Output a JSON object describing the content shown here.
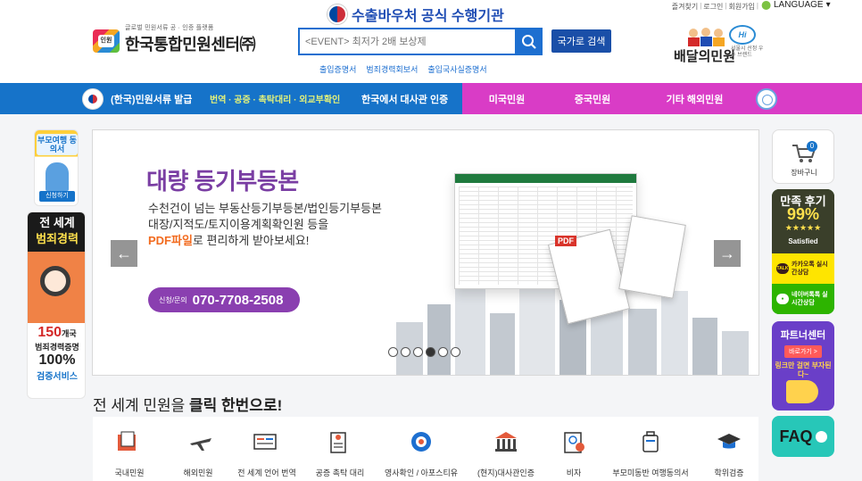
{
  "header": {
    "top_links": [
      "즐겨찾기",
      "로그인",
      "회원가입"
    ],
    "language": "LANGUAGE",
    "gov_banner": "수출바우처 공식 수행기관",
    "logo_small": "글로벌 민원서류 공 · 인증 플랫폼",
    "logo_mark": "인원",
    "logo_name": "한국통합민원센터㈜",
    "search_placeholder": "<EVENT> 최저가 2배 보상제",
    "country_search": "국가로 검색",
    "quick_links": [
      "출입증명서",
      "범죄경력회보서",
      "출입국사실증명서"
    ],
    "delivery_name_a": "배달의",
    "delivery_name_b": "민원",
    "delivery_hi": "Hi",
    "delivery_small": "서울시 선정 우수 브랜드"
  },
  "nav": {
    "items": [
      "(한국)민원서류 발급",
      "번역 · 공증 · 촉탁대리 · 외교부확인",
      "한국에서 대사관 인증",
      "미국민원",
      "중국민원",
      "기타 해외민원"
    ]
  },
  "slider": {
    "title": "대량 등기부등본",
    "line1": "수천건이 넘는 부동산등기부등본/법인등기부등본",
    "line2": "대장/지적도/토지이용계획확인원 등을",
    "line3_highlight": "PDF파일",
    "line3_rest": "로 편리하게 받아보세요!",
    "contact_label": "신청/문의",
    "contact_phone": "070-7708-2508",
    "pdf_tag": "PDF",
    "prev": "←",
    "next": "→",
    "dots_total": 6,
    "dots_active": 4
  },
  "left_ads": {
    "ad1_title": "부모여행 동의서",
    "ad1_button": "신청하기",
    "ad2_title_a": "전 세계",
    "ad2_title_b": "범죄경력",
    "ad2_count": "150",
    "ad2_count_unit": "개국",
    "ad2_line": "범죄경력증명",
    "ad2_percent": "100%",
    "ad2_service": "검증서비스"
  },
  "right_ads": {
    "cart_count": "0",
    "cart_label": "장바구니",
    "review_title": "만족 후기",
    "review_pct": "99%",
    "review_sat": "Satisfied",
    "kakao_chip": "TALK",
    "kakao": "카카오톡 실시간상담",
    "naver": "네이버톡톡 실시간상담",
    "partner_title": "파트너센터",
    "partner_btn": "바로가기 >",
    "partner_sub": "링크만 걸면 부자된다~",
    "faq": "FAQ"
  },
  "section": {
    "title_pre": "전 세계 민원을 ",
    "title_b1": "클릭",
    "title_mid": " ",
    "title_b2": "한번으로!",
    "categories": [
      "국내민원",
      "해외민원",
      "전 세계 언어 번역",
      "공증 촉탁 대리",
      "영사확인 / 아포스티유",
      "(현지)대사관인증",
      "비자",
      "부모미동반 여행동의서",
      "학위검증"
    ]
  },
  "colors": {
    "nav_blue": "#1673c9",
    "nav_pink": "#d93cc6",
    "accent_purple": "#7a3ea3",
    "accent_orange": "#f26b1f",
    "primary_blue": "#1d6fd0"
  }
}
